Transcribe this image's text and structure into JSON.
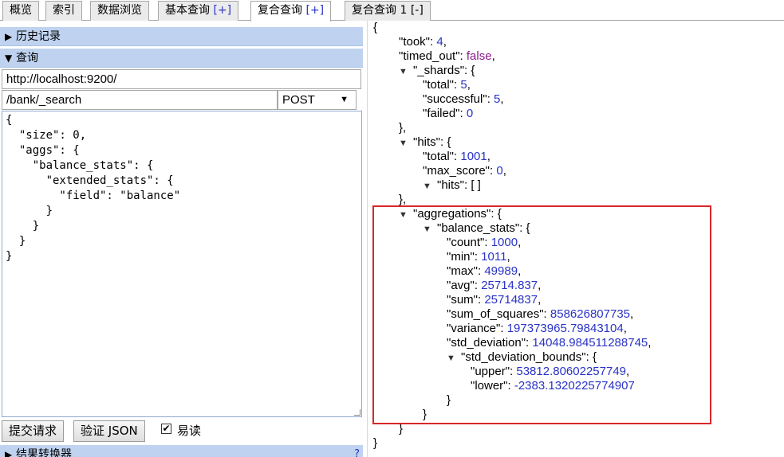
{
  "tabs": [
    {
      "label": "概览",
      "suffix": ""
    },
    {
      "label": "索引",
      "suffix": ""
    },
    {
      "label": "数据浏览",
      "suffix": ""
    },
    {
      "label": "基本查询",
      "suffix": "[+]"
    },
    {
      "label": "复合查询",
      "suffix": "[+]"
    },
    {
      "label": "复合查询 1",
      "suffix": "[-]"
    }
  ],
  "left": {
    "history_label": "历史记录",
    "query_label": "查询",
    "url": "http://localhost:9200/",
    "path": "/bank/_search",
    "method": "POST",
    "body_lines": [
      "{",
      "  \"size\": 0,",
      "  \"aggs\": {",
      "    \"balance_stats\": {",
      "      \"extended_stats\": {",
      "        \"field\": \"balance\"",
      "      }",
      "    }",
      "  }",
      "}"
    ],
    "submit_label": "提交请求",
    "validate_label": "验证 JSON",
    "pretty_label": "易读",
    "pretty_checked": "✔",
    "transformer_label": "结果转换器",
    "help_mark": "?"
  },
  "response": {
    "took_key": "\"took\"",
    "took": "4",
    "timed_out_key": "\"timed_out\"",
    "timed_out": "false",
    "shards_key": "\"_shards\"",
    "total_key": "\"total\"",
    "shards_total": "5",
    "successful_key": "\"successful\"",
    "successful": "5",
    "failed_key": "\"failed\"",
    "failed": "0",
    "hits_key": "\"hits\"",
    "hits_total": "1001",
    "max_score_key": "\"max_score\"",
    "max_score": "0",
    "hits_array": "[ ]",
    "aggregations_key": "\"aggregations\"",
    "balance_stats_key": "\"balance_stats\"",
    "count_key": "\"count\"",
    "count": "1000",
    "min_key": "\"min\"",
    "min": "1011",
    "max_key": "\"max\"",
    "max": "49989",
    "avg_key": "\"avg\"",
    "avg": "25714.837",
    "sum_key": "\"sum\"",
    "sum": "25714837",
    "sum_of_squares_key": "\"sum_of_squares\"",
    "sum_of_squares": "858626807735",
    "variance_key": "\"variance\"",
    "variance": "197373965.79843104",
    "std_deviation_key": "\"std_deviation\"",
    "std_deviation": "14048.984511288745",
    "std_deviation_bounds_key": "\"std_deviation_bounds\"",
    "upper_key": "\"upper\"",
    "upper": "53812.80602257749",
    "lower_key": "\"lower\"",
    "lower": "-2383.1320225774907"
  },
  "colors": {
    "number": "#2a33c6",
    "boolean": "#8b1b8b",
    "highlight": "#d9262a",
    "section": "#bfd3f0"
  }
}
